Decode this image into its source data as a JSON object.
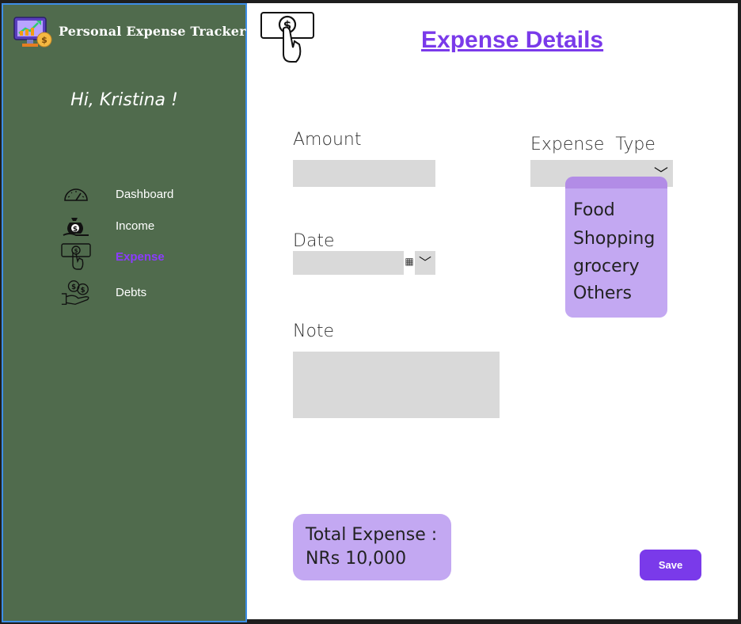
{
  "app": {
    "title": "Personal Expense Tracker",
    "greeting": "Hi, Kristina !"
  },
  "sidebar": {
    "items": [
      {
        "label": "Dashboard",
        "icon": "speedometer-icon",
        "active": false
      },
      {
        "label": "Income",
        "icon": "money-bag-icon",
        "active": false
      },
      {
        "label": "Expense",
        "icon": "cash-hand-icon",
        "active": true
      },
      {
        "label": "Debts",
        "icon": "hand-coins-icon",
        "active": false
      }
    ]
  },
  "main": {
    "title": "Expense Details",
    "header_icon": "cash-hand-icon"
  },
  "form": {
    "amount_label": "Amount",
    "amount_value": "",
    "expense_type_label": "Expense  Type",
    "expense_type_value": "",
    "expense_type_options": [
      "Food",
      "Shopping",
      "grocery",
      "Others"
    ],
    "date_label": "Date",
    "date_value": "",
    "note_label": "Note",
    "note_value": ""
  },
  "summary": {
    "total_label": "Total Expense :",
    "total_value": "NRs 10,000"
  },
  "buttons": {
    "save_label": "Save"
  },
  "colors": {
    "sidebar_bg": "#506b4d",
    "sidebar_border": "#3d8ee6",
    "accent_purple": "#7a3aea",
    "card_lavender": "#c3a8f2",
    "input_gray": "#d9d9d9"
  }
}
